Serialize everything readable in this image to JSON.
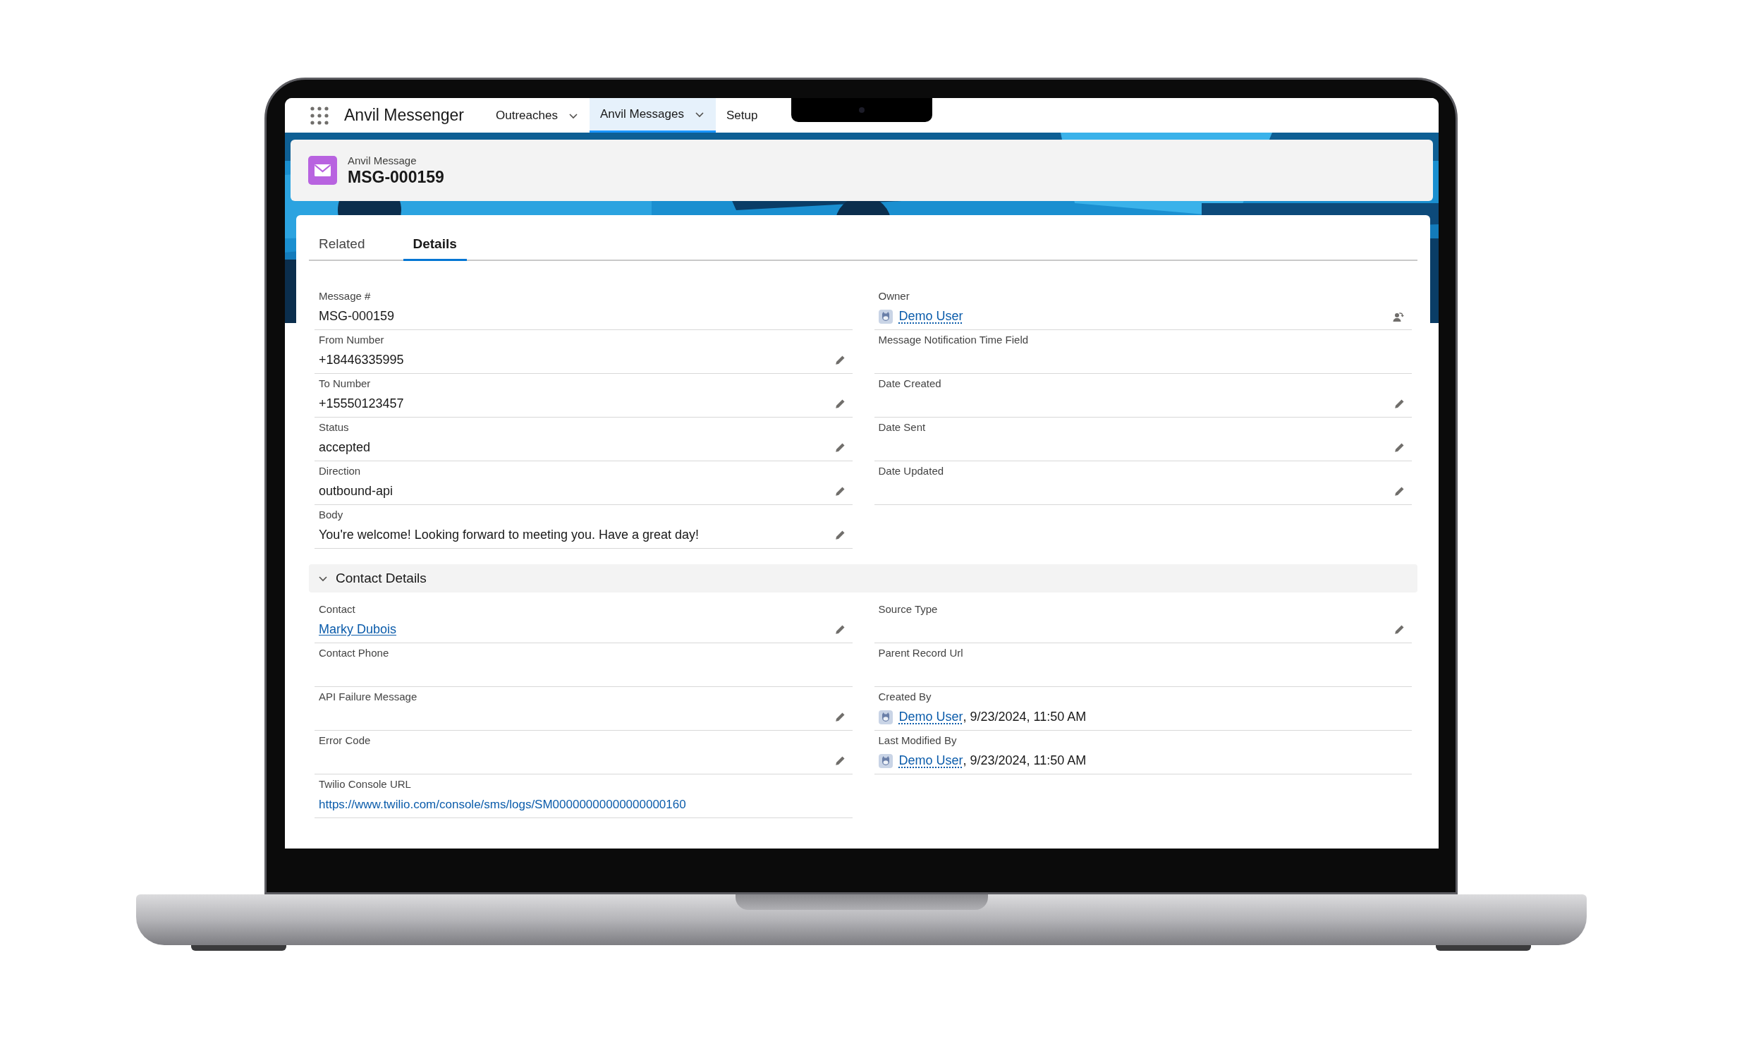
{
  "app": {
    "name": "Anvil Messenger"
  },
  "nav_tabs": [
    {
      "label": "Outreaches",
      "selected": false,
      "has_menu": true
    },
    {
      "label": "Anvil Messages",
      "selected": true,
      "has_menu": true
    },
    {
      "label": "Setup",
      "selected": false,
      "has_menu": false
    }
  ],
  "record": {
    "type": "Anvil Message",
    "name": "MSG-000159"
  },
  "tabs": [
    {
      "label": "Related",
      "selected": false
    },
    {
      "label": "Details",
      "selected": true
    }
  ],
  "sections": [
    {
      "columns": [
        [
          {
            "label": "Message #",
            "kind": "text",
            "value": "MSG-000159",
            "editable": false,
            "reassignable": false
          },
          {
            "label": "From Number",
            "kind": "text",
            "value": "+18446335995",
            "editable": true,
            "reassignable": false
          },
          {
            "label": "To Number",
            "kind": "text",
            "value": "+15550123457",
            "editable": true,
            "reassignable": false
          },
          {
            "label": "Status",
            "kind": "text",
            "value": "accepted",
            "editable": true,
            "reassignable": false
          },
          {
            "label": "Direction",
            "kind": "text",
            "value": "outbound-api",
            "editable": true,
            "reassignable": false
          },
          {
            "label": "Body",
            "kind": "text",
            "value": "You're welcome! Looking forward to meeting you. Have a great day!",
            "editable": true,
            "reassignable": false
          }
        ],
        [
          {
            "label": "Owner",
            "kind": "user",
            "user": "Demo User",
            "editable": false,
            "reassignable": true
          },
          {
            "label": "Message Notification Time Field",
            "kind": "text",
            "editable": false,
            "reassignable": false
          },
          {
            "label": "Date Created",
            "kind": "text",
            "editable": true,
            "reassignable": false
          },
          {
            "label": "Date Sent",
            "kind": "text",
            "editable": true,
            "reassignable": false
          },
          {
            "label": "Date Updated",
            "kind": "text",
            "editable": true,
            "reassignable": false
          }
        ]
      ]
    },
    {
      "title": "Contact Details",
      "expanded": true,
      "columns": [
        [
          {
            "label": "Contact",
            "kind": "link",
            "value": "Marky Dubois",
            "editable": true,
            "reassignable": false
          },
          {
            "label": "Contact Phone",
            "kind": "text",
            "editable": false,
            "reassignable": false
          },
          {
            "label": "API Failure Message",
            "kind": "text",
            "editable": true,
            "reassignable": false
          },
          {
            "label": "Error Code",
            "kind": "text",
            "editable": true,
            "reassignable": false
          },
          {
            "label": "Twilio Console URL",
            "kind": "url",
            "value": "https://www.twilio.com/console/sms/logs/SM00000000000000000160",
            "editable": false,
            "reassignable": false
          }
        ],
        [
          {
            "label": "Source Type",
            "kind": "text",
            "editable": true,
            "reassignable": false
          },
          {
            "label": "Parent Record Url",
            "kind": "text",
            "editable": false,
            "reassignable": false
          },
          {
            "label": "Created By",
            "kind": "user",
            "user": "Demo User",
            "suffix": ", 9/23/2024, 11:50 AM",
            "editable": false,
            "reassignable": false
          },
          {
            "label": "Last Modified By",
            "kind": "user",
            "user": "Demo User",
            "suffix": ", 9/23/2024, 11:50 AM",
            "editable": false,
            "reassignable": false
          }
        ]
      ]
    }
  ]
}
